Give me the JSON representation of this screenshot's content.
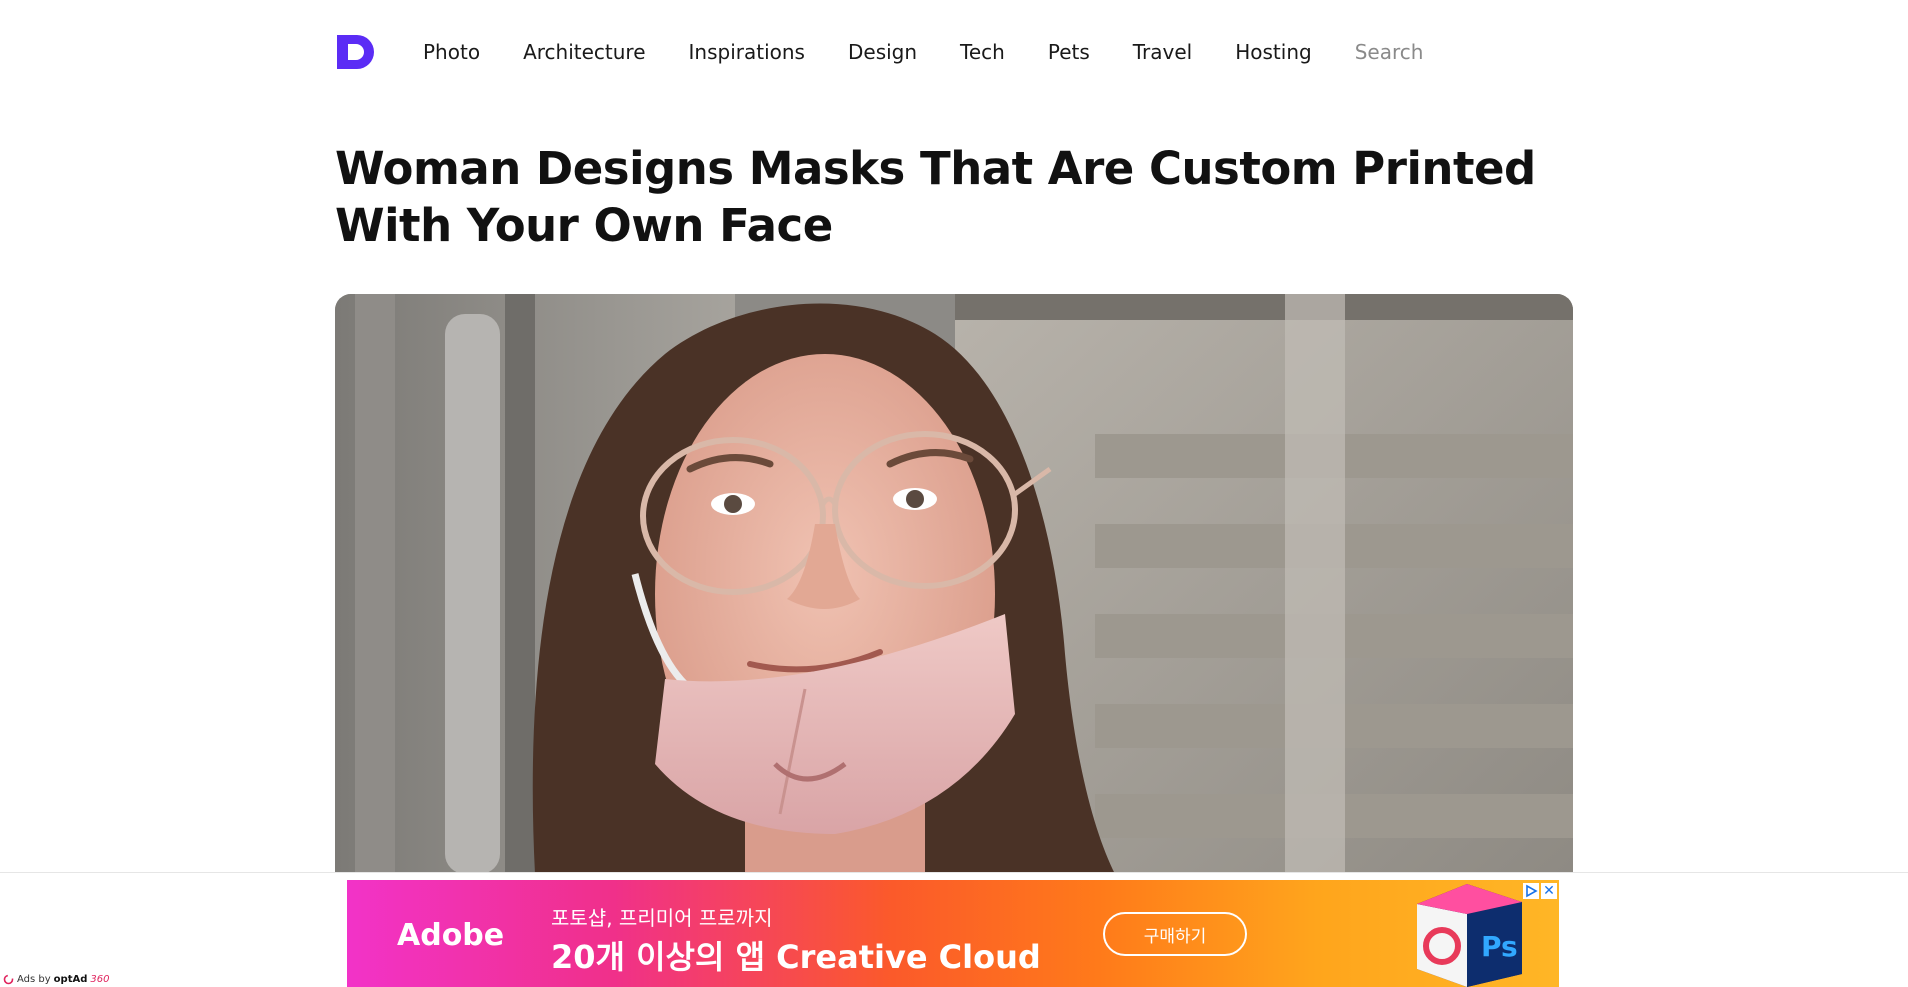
{
  "header": {
    "nav": [
      "Photo",
      "Architecture",
      "Inspirations",
      "Design",
      "Tech",
      "Pets",
      "Travel",
      "Hosting"
    ],
    "search_placeholder": "Search"
  },
  "article": {
    "title": "Woman Designs Masks That Are Custom Printed With Your Own Face"
  },
  "ad": {
    "brand": "Adobe",
    "line1": "포토샵, 프리미어 프로까지",
    "line2": "20개 이상의 앱 Creative Cloud",
    "cta": "구매하기",
    "close_symbol": "✕",
    "ads_by_label": "Ads by",
    "ads_by_brand": "optAd",
    "ads_by_brand_num": "360"
  },
  "colors": {
    "logo": "#5b2cf5",
    "ad_gradient_start": "#f233c8",
    "ad_gradient_end": "#ffb626"
  }
}
